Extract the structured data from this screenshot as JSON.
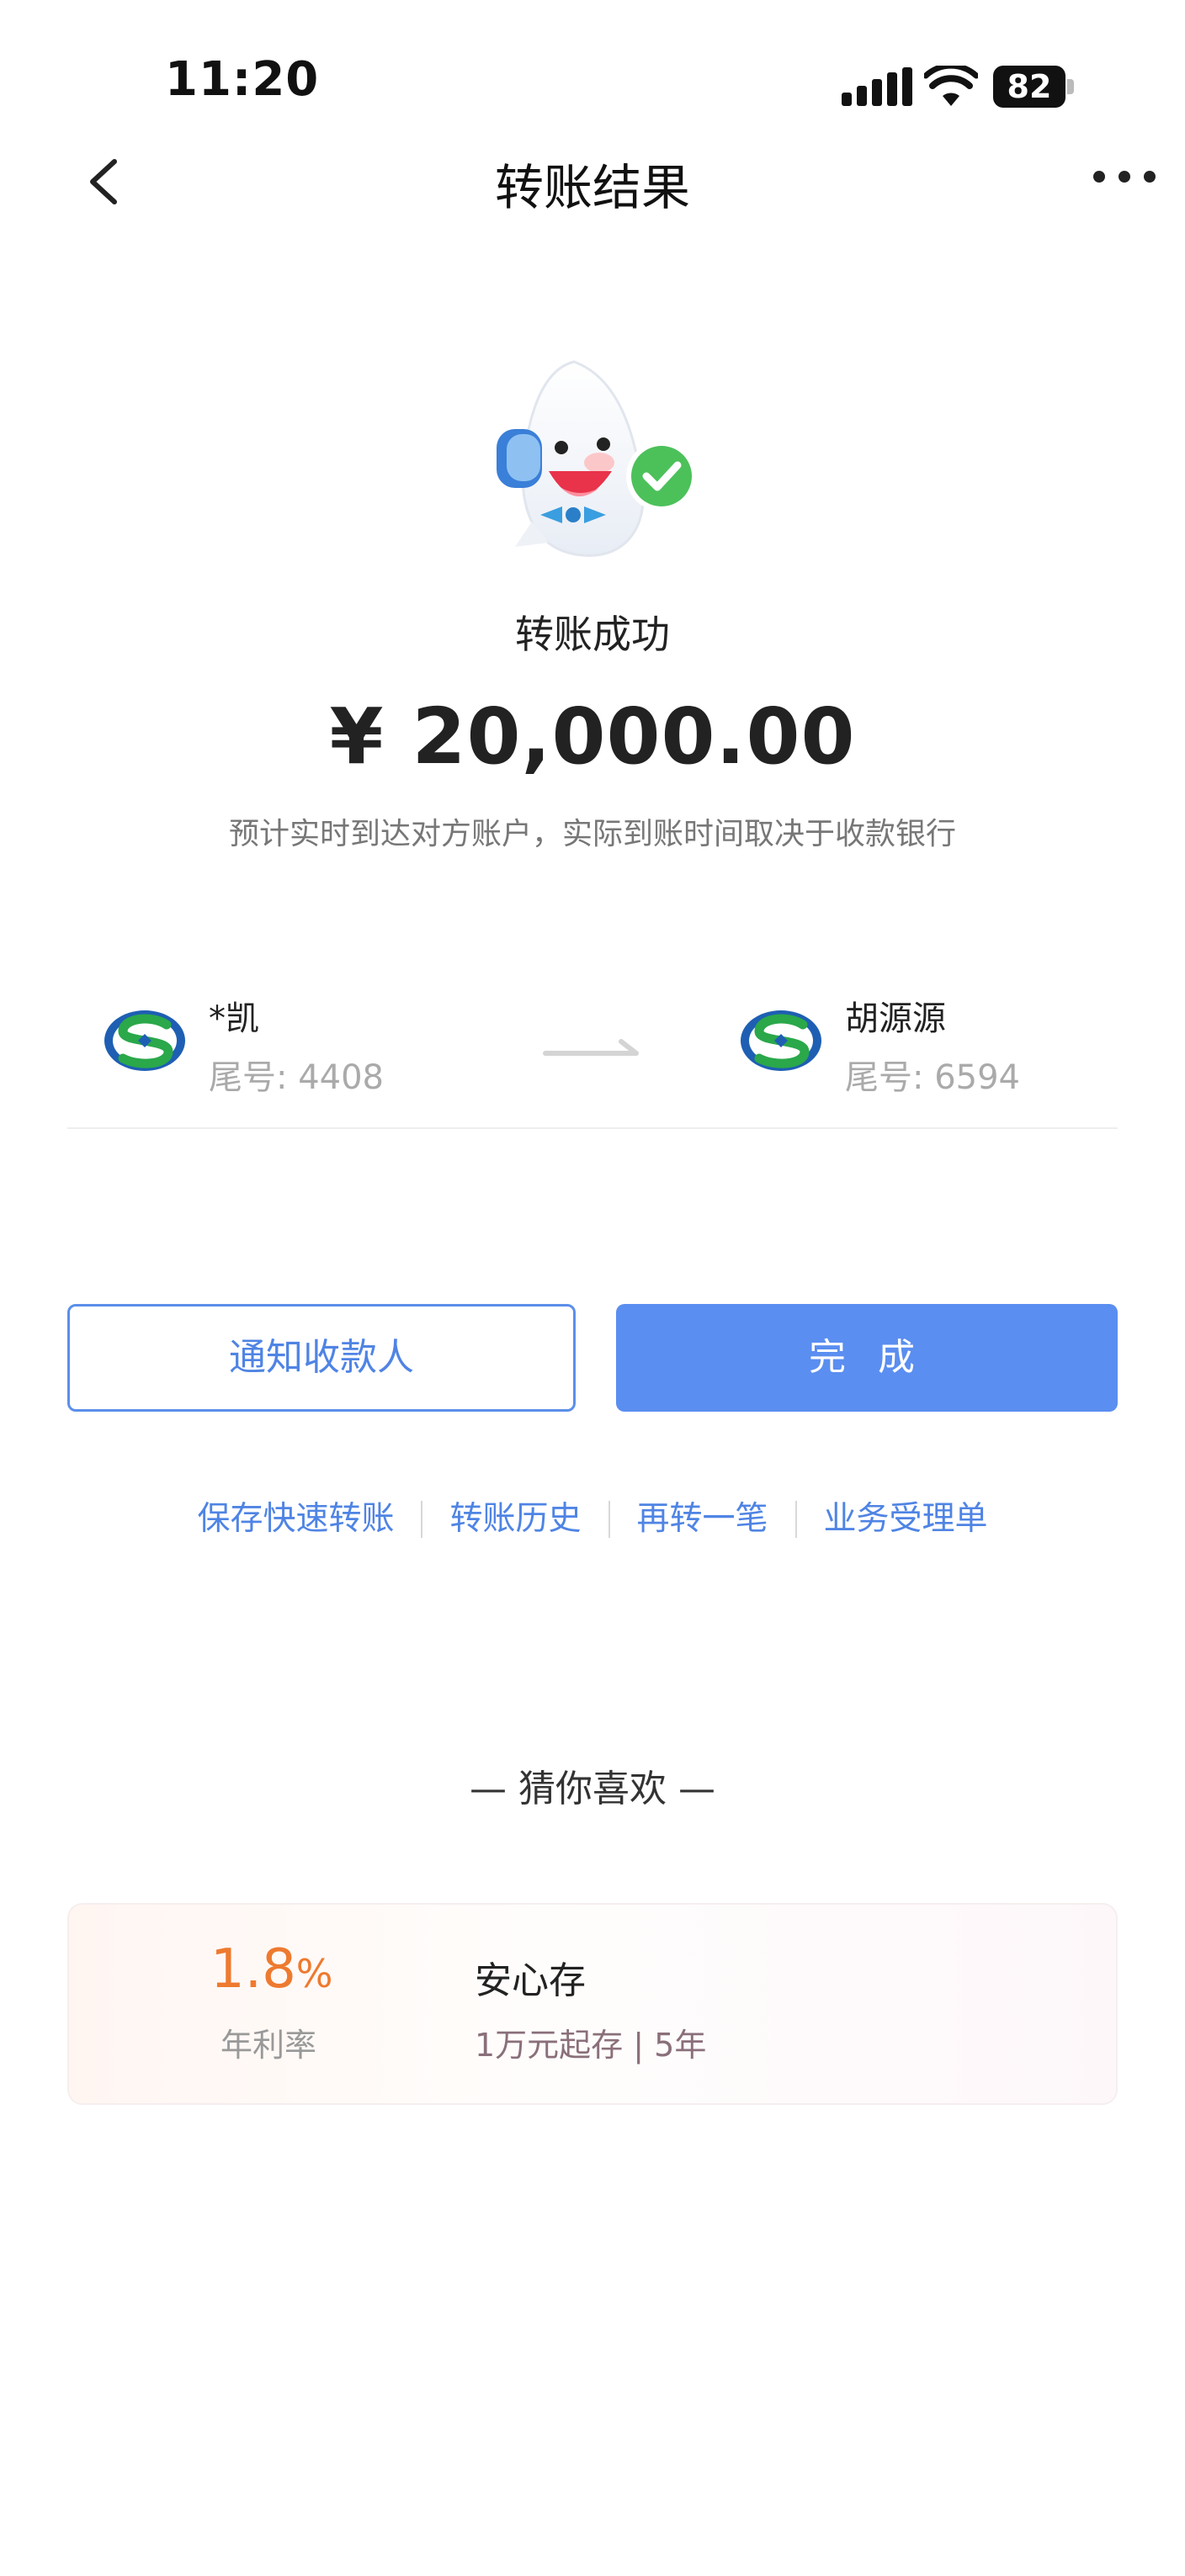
{
  "status_bar": {
    "time": "11:20",
    "battery": "82"
  },
  "header": {
    "title": "转账结果"
  },
  "result": {
    "status_text": "转账成功",
    "amount": "¥ 20,000.00",
    "note": "预计实时到达对方账户，实际到账时间取决于收款银行"
  },
  "payer": {
    "name": "*凯",
    "tail": "尾号: 4408"
  },
  "payee": {
    "name": "胡源源",
    "tail": "尾号: 6594"
  },
  "buttons": {
    "notify": "通知收款人",
    "done": "完 成"
  },
  "quick_links": [
    "保存快速转账",
    "转账历史",
    "再转一笔",
    "业务受理单"
  ],
  "recommend": {
    "title": "— 猜你喜欢 —",
    "rate_number": "1.8",
    "rate_unit": "%",
    "rate_label": "年利率",
    "product_name": "安心存",
    "product_desc": "1万元起存 | 5年"
  },
  "colors": {
    "accent": "#5a8ef0",
    "rate": "#ee7a2f",
    "success": "#4cc15a"
  },
  "icons": [
    "back-arrow-icon",
    "more-icon",
    "signal-icon",
    "wifi-icon",
    "battery-icon",
    "bank-logo-icon",
    "transfer-arrow-icon",
    "success-check-icon"
  ]
}
